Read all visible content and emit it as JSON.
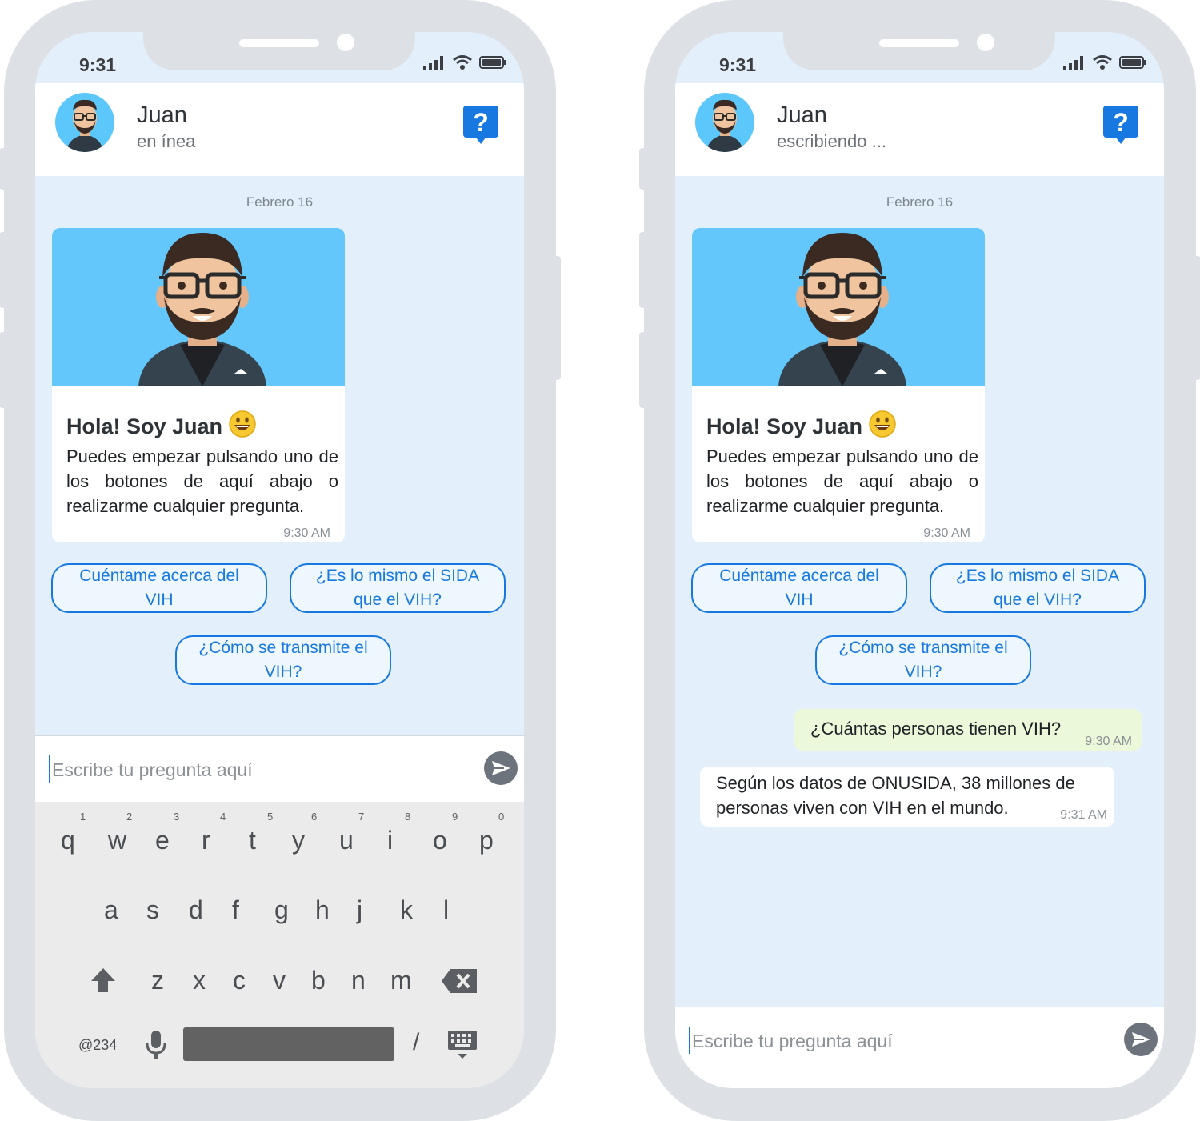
{
  "status_bar": {
    "time": "9:31"
  },
  "header": {
    "contact_name": "Juan",
    "left_status": "en ínea",
    "right_status": "escribiendo ..."
  },
  "chat": {
    "date_separator": "Febrero 16",
    "welcome_card": {
      "title": "Hola! Soy Juan",
      "emoji": "😃",
      "text": "Puedes empezar pulsando uno de los botones de aquí abajo o realizarme cualquier pregunta.",
      "time": "9:30 AM"
    },
    "quick_replies": [
      "Cuéntame acerca del VIH",
      "¿Es lo mismo el SIDA que el VIH?",
      "¿Cómo se transmite el VIH?"
    ],
    "messages": [
      {
        "from": "user",
        "text": "¿Cuántas personas tienen VIH?",
        "time": "9:30 AM"
      },
      {
        "from": "bot",
        "text_line1": "Según los datos de ONUSIDA, 38 millones de",
        "text_line2": "personas viven con VIH en el mundo.",
        "time": "9:31 AM"
      }
    ]
  },
  "input": {
    "placeholder": "Escribe tu pregunta aquí"
  },
  "keyboard": {
    "numbers": [
      "1",
      "2",
      "3",
      "4",
      "5",
      "6",
      "7",
      "8",
      "9",
      "0"
    ],
    "row1": [
      "q",
      "w",
      "e",
      "r",
      "t",
      "y",
      "u",
      "i",
      "o",
      "p"
    ],
    "row2": [
      "a",
      "s",
      "d",
      "f",
      "g",
      "h",
      "j",
      "k",
      "l"
    ],
    "row3": [
      "z",
      "x",
      "c",
      "v",
      "b",
      "n",
      "m"
    ],
    "symbols_key": "@234",
    "slash_key": "/"
  },
  "colors": {
    "accent": "#1678e0",
    "chat_bg": "#e3f0fb",
    "avatar_bg": "#63c7fc",
    "outgoing_bubble": "#ebf8d9",
    "phone_frame": "#dde1e6"
  },
  "icons": {
    "status": [
      "signal-icon",
      "wifi-icon",
      "battery-icon"
    ],
    "help": "help-question-icon",
    "send": "send-icon",
    "shift": "shift-icon",
    "backspace": "backspace-icon",
    "mic": "microphone-icon",
    "keyboard": "keyboard-icon"
  }
}
